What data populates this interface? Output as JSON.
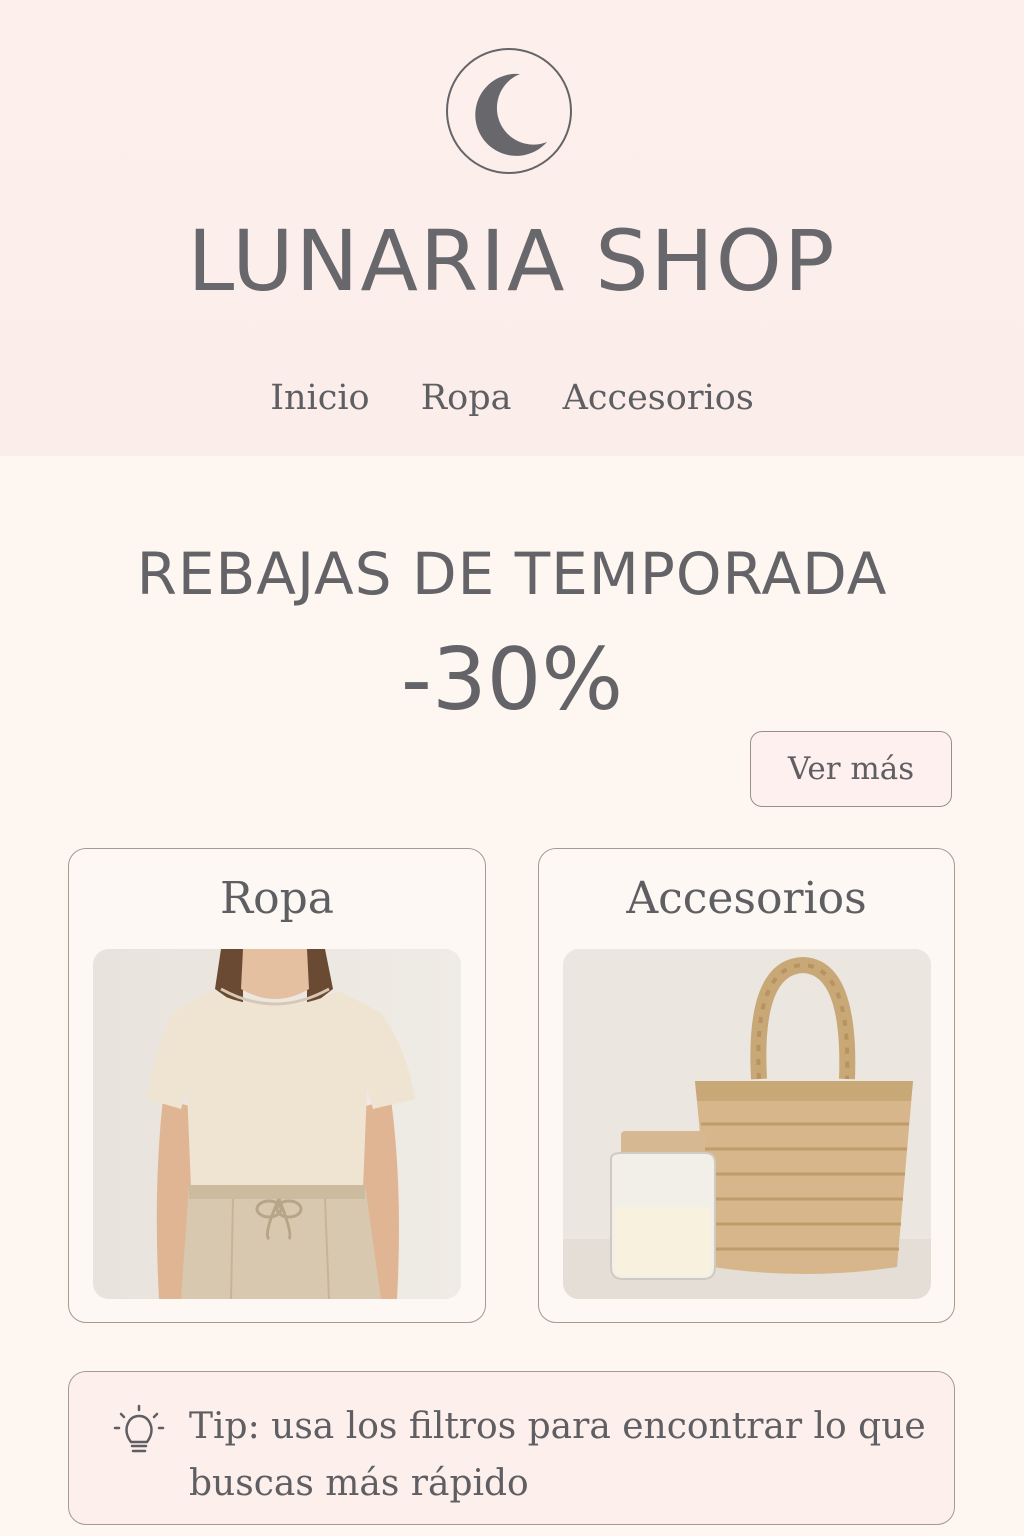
{
  "brand": {
    "logo_icon": "crescent-moon-icon",
    "name": "LUNARIA SHOP"
  },
  "nav": {
    "items": [
      {
        "label": "Inicio"
      },
      {
        "label": "Ropa"
      },
      {
        "label": "Accesorios"
      }
    ]
  },
  "promo": {
    "title": "REBAJAS DE TEMPORADA",
    "discount": "-30%",
    "button_label": "Ver más"
  },
  "categories": [
    {
      "label": "Ropa",
      "image": "cream-tshirt-and-linen-trousers-photo"
    },
    {
      "label": "Accesorios",
      "image": "jar-candle-and-woven-straw-bag-photo"
    }
  ],
  "tip": {
    "icon": "lightbulb-icon",
    "text": "Tip: usa los filtros para encontrar lo que buscas más rápido"
  },
  "colors": {
    "header_bg": "#fcefec",
    "page_bg": "#fdf6f1",
    "text": "#5f5f63",
    "border": "#a59a92"
  }
}
